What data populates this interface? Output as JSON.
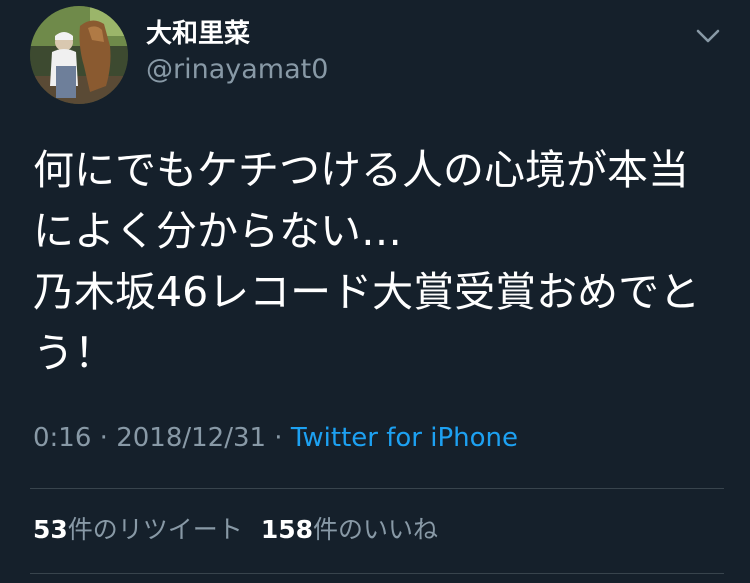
{
  "user": {
    "display_name": "大和里菜",
    "handle": "@rinayamat0",
    "avatar_icon": "avatar-photo-with-horse"
  },
  "tweet": {
    "lines": [
      "何にでもケチつける人の心境が本当",
      "によく分からない…",
      "乃木坂46レコード大賞受賞おめでと",
      "う！"
    ]
  },
  "meta": {
    "time": "0:16",
    "separator1": " · ",
    "date": "2018/12/31",
    "separator2": " · ",
    "source": "Twitter for iPhone"
  },
  "stats": {
    "retweets_count": "53",
    "retweets_label": "件のリツイート",
    "likes_count": "158",
    "likes_label": "件のいいね"
  },
  "icons": {
    "menu": "chevron-down-icon"
  },
  "colors": {
    "background": "#15202b",
    "text": "#ffffff",
    "secondary": "#8899a6",
    "link": "#1da1f2",
    "divider": "#38444d"
  }
}
